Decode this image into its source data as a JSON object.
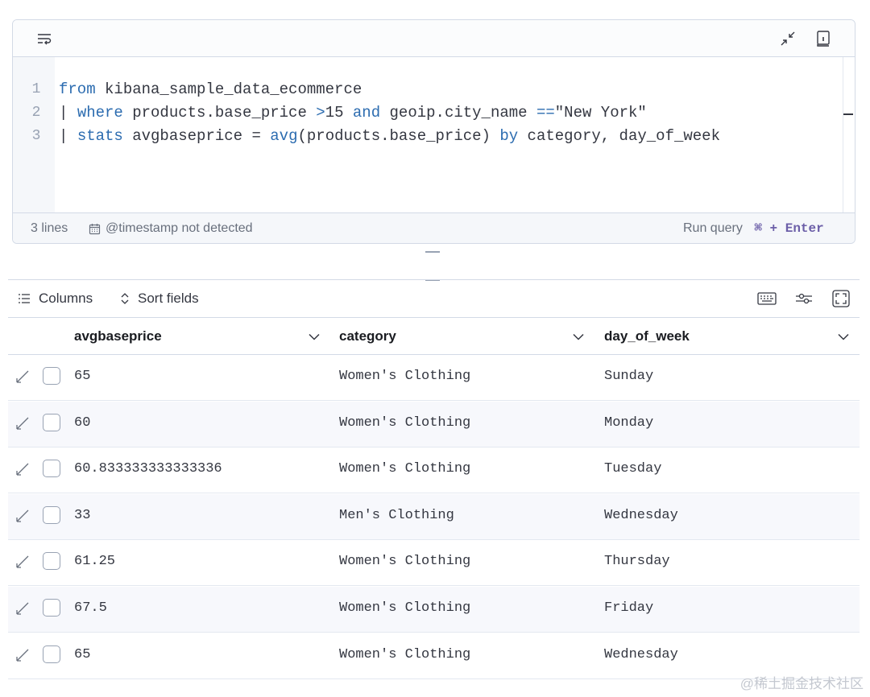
{
  "editor": {
    "lines": [
      {
        "num": "1",
        "tokens": [
          {
            "t": "from",
            "k": "kw"
          },
          {
            "t": " kibana_sample_data_ecommerce",
            "k": "id"
          }
        ]
      },
      {
        "num": "2",
        "tokens": [
          {
            "t": "| ",
            "k": "id"
          },
          {
            "t": "where",
            "k": "kw"
          },
          {
            "t": " products.base_price ",
            "k": "id"
          },
          {
            "t": ">",
            "k": "kw"
          },
          {
            "t": "15 ",
            "k": "id"
          },
          {
            "t": "and",
            "k": "kw"
          },
          {
            "t": " geoip.city_name ",
            "k": "id"
          },
          {
            "t": "==",
            "k": "kw"
          },
          {
            "t": "\"New York\"",
            "k": "id"
          }
        ]
      },
      {
        "num": "3",
        "tokens": [
          {
            "t": "| ",
            "k": "id"
          },
          {
            "t": "stats",
            "k": "kw"
          },
          {
            "t": " avgbaseprice = ",
            "k": "id"
          },
          {
            "t": "avg",
            "k": "kw"
          },
          {
            "t": "(products.base_price) ",
            "k": "id"
          },
          {
            "t": "by",
            "k": "kw"
          },
          {
            "t": " category, day_of_week",
            "k": "id"
          }
        ]
      }
    ],
    "icons": {
      "wrap": "word-wrap-icon",
      "minimize": "minimize-icon",
      "docs": "documentation-icon"
    },
    "footer": {
      "line_count": "3 lines",
      "timestamp_status": "@timestamp not detected",
      "run_label": "Run query",
      "shortcut": "⌘ + Enter"
    }
  },
  "grid_toolbar": {
    "columns_label": "Columns",
    "sort_label": "Sort fields",
    "icons": [
      "keyboard-icon",
      "display-settings-icon",
      "fullscreen-icon"
    ]
  },
  "table": {
    "columns": [
      "avgbaseprice",
      "category",
      "day_of_week"
    ],
    "rows": [
      [
        "65",
        "Women's Clothing",
        "Sunday"
      ],
      [
        "60",
        "Women's Clothing",
        "Monday"
      ],
      [
        "60.833333333333336",
        "Women's Clothing",
        "Tuesday"
      ],
      [
        "33",
        "Men's Clothing",
        "Wednesday"
      ],
      [
        "61.25",
        "Women's Clothing",
        "Thursday"
      ],
      [
        "67.5",
        "Women's Clothing",
        "Friday"
      ],
      [
        "65",
        "Women's Clothing",
        "Wednesday"
      ]
    ]
  },
  "watermark": "@稀土掘金技术社区",
  "colors": {
    "keyword": "#2c6cb0",
    "shortcut": "#6c5fa8",
    "border": "#d3dae6",
    "row_alt": "#f7f8fc"
  }
}
